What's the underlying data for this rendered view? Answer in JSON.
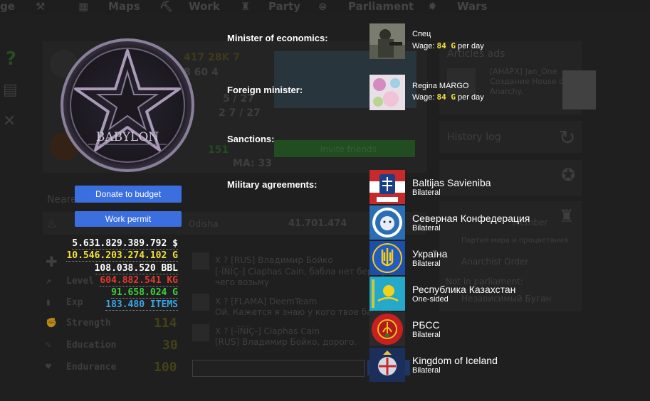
{
  "nav": [
    {
      "label": "Maps"
    },
    {
      "label": "Work"
    },
    {
      "label": "Party"
    },
    {
      "label": "Parliament"
    },
    {
      "label": "Wars"
    }
  ],
  "background": {
    "articles_title": "Articles ads",
    "article_author": "[АНАРХ] Jan_One",
    "article_text1": "Создание House of",
    "article_text2": "Anarchy.",
    "history_title": "History log",
    "party_member": "Member",
    "party_text": "Партия мира и процветания",
    "party_item": "Anarchist Order",
    "not_parl": "Not in parliament:",
    "indep": "Независимый Буган",
    "nearest": "Neare",
    "region": "Odisha",
    "region_val": "41.701.474",
    "invite": "Invite friends",
    "stats_top": "417  28K  7",
    "stats_mid": "8  60  4",
    "stats_l3": "5 / 27",
    "stats_l4": "2  7 / 27",
    "lvl_num": "151",
    "ma": "MA: 33",
    "stat_strength": "Strength",
    "stat_education": "Education",
    "stat_endurance": "Endurance",
    "stat_level": "Level",
    "stat_exp": "Exp",
    "val_strength": "114",
    "val_education": "30",
    "val_endurance": "100",
    "chat1_name": "X  ?  [RUS] Владимир Бойко",
    "chat1_text1": "[-ÏÑÏÇ-] Ciaphas Cain, бабла нет бери у",
    "chat1_text2": "чего возьму",
    "chat2_name": "X  ?  [FLAMA] DeemTeam",
    "chat2_text": "Ой. Кажется я знаю у кого твое бабло)",
    "chat3_name": "X  ?  [-ÏÑÏÇ-] Ciaphas Cain",
    "chat3_text": "[RUS] Владимир Бойко, дорого."
  },
  "emblem": {
    "name": "BABYLON"
  },
  "buttons": {
    "donate": "Donate to budget",
    "permit": "Work permit"
  },
  "resources": [
    {
      "value": "5.631.829.389.792 $",
      "color": "#ffffff"
    },
    {
      "value": "10.546.203.274.102 G",
      "color": "#f2e23a"
    },
    {
      "value": "108.038.520 BBL",
      "color": "#ffffff"
    },
    {
      "value": "604.882.541 KG",
      "color": "#e23b2e"
    },
    {
      "value": "91.658.024 G",
      "color": "#3bd23b"
    },
    {
      "value": "183.480 ITEMS",
      "color": "#3aa7ef"
    }
  ],
  "ministers": {
    "economics_label": "Minister of economics:",
    "economics_name": "Спец",
    "economics_wage_prefix": "Wage:",
    "economics_wage_value": "84 G",
    "economics_wage_suffix": "per day",
    "foreign_label": "Foreign minister:",
    "foreign_name": "Regina MARGO",
    "foreign_wage_prefix": "Wage:",
    "foreign_wage_value": "84 G",
    "foreign_wage_suffix": "per day"
  },
  "sanctions_label": "Sanctions:",
  "military_label": "Military agreements:",
  "agreements": [
    {
      "country": "Baltijas Savieniba",
      "type": "Bilateral"
    },
    {
      "country": "Северная Конфедерация",
      "type": "Bilateral"
    },
    {
      "country": "Україна",
      "type": "Bilateral"
    },
    {
      "country": "Республика Казахстан",
      "type": "One-sided"
    },
    {
      "country": "РБСС",
      "type": "Bilateral"
    },
    {
      "country": "Kingdom of Iceland",
      "type": "Bilateral"
    }
  ],
  "colors": {
    "button": "#3b6fe0",
    "gold": "#f2e23a"
  }
}
